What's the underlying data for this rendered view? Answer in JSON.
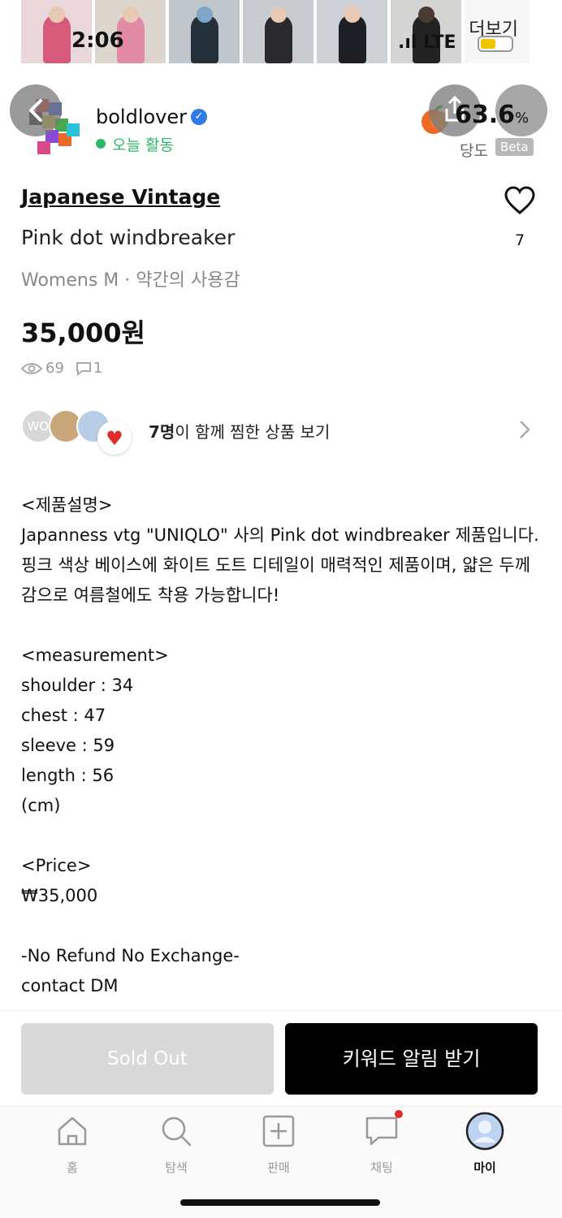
{
  "status_bar": {
    "time": "2:06",
    "network": "LTE"
  },
  "top_strip": {
    "more_label": "더보기"
  },
  "seller": {
    "name": "boldlover",
    "activity": "오늘 활동",
    "score_value": "63.6",
    "score_unit": "%",
    "score_label": "당도",
    "beta_label": "Beta"
  },
  "product": {
    "brand": "Japanese Vintage",
    "title": "Pink dot windbreaker",
    "meta": "Womens M · 약간의 사용감",
    "price": "35,000원",
    "likes": "7",
    "views": "69",
    "comments": "1"
  },
  "liked_together": {
    "avatar_text": "WO",
    "count": "7명",
    "text": "이 함께 찜한 상품 보기"
  },
  "description": [
    "<제품설명>",
    "Japanness vtg \"UNIQLO\" 사의 Pink dot windbreaker 제품입니다. 핑크 색상 베이스에 화이트 도트 디테일이 매력적인 제품이며, 얇은 두께감으로 여름철에도 착용 가능합니다!",
    "",
    "<measurement>",
    "shoulder : 34",
    "chest : 47",
    "sleeve : 59",
    "length : 56",
    "(cm)",
    "",
    "<Price>",
    "₩35,000",
    "",
    "-No Refund No Exchange-",
    "contact DM"
  ],
  "actions": {
    "sold_out": "Sold Out",
    "keyword_alert": "키워드 알림 받기"
  },
  "tabs": [
    {
      "label": "홈",
      "icon": "home-icon"
    },
    {
      "label": "탐색",
      "icon": "search-icon"
    },
    {
      "label": "판매",
      "icon": "plus-square-icon"
    },
    {
      "label": "채팅",
      "icon": "chat-bubble-icon"
    },
    {
      "label": "마이",
      "icon": "profile-avatar-icon"
    }
  ],
  "colors": {
    "accent_green": "#2fb865",
    "verified_blue": "#2f7be8",
    "like_red": "#e02b2b"
  }
}
